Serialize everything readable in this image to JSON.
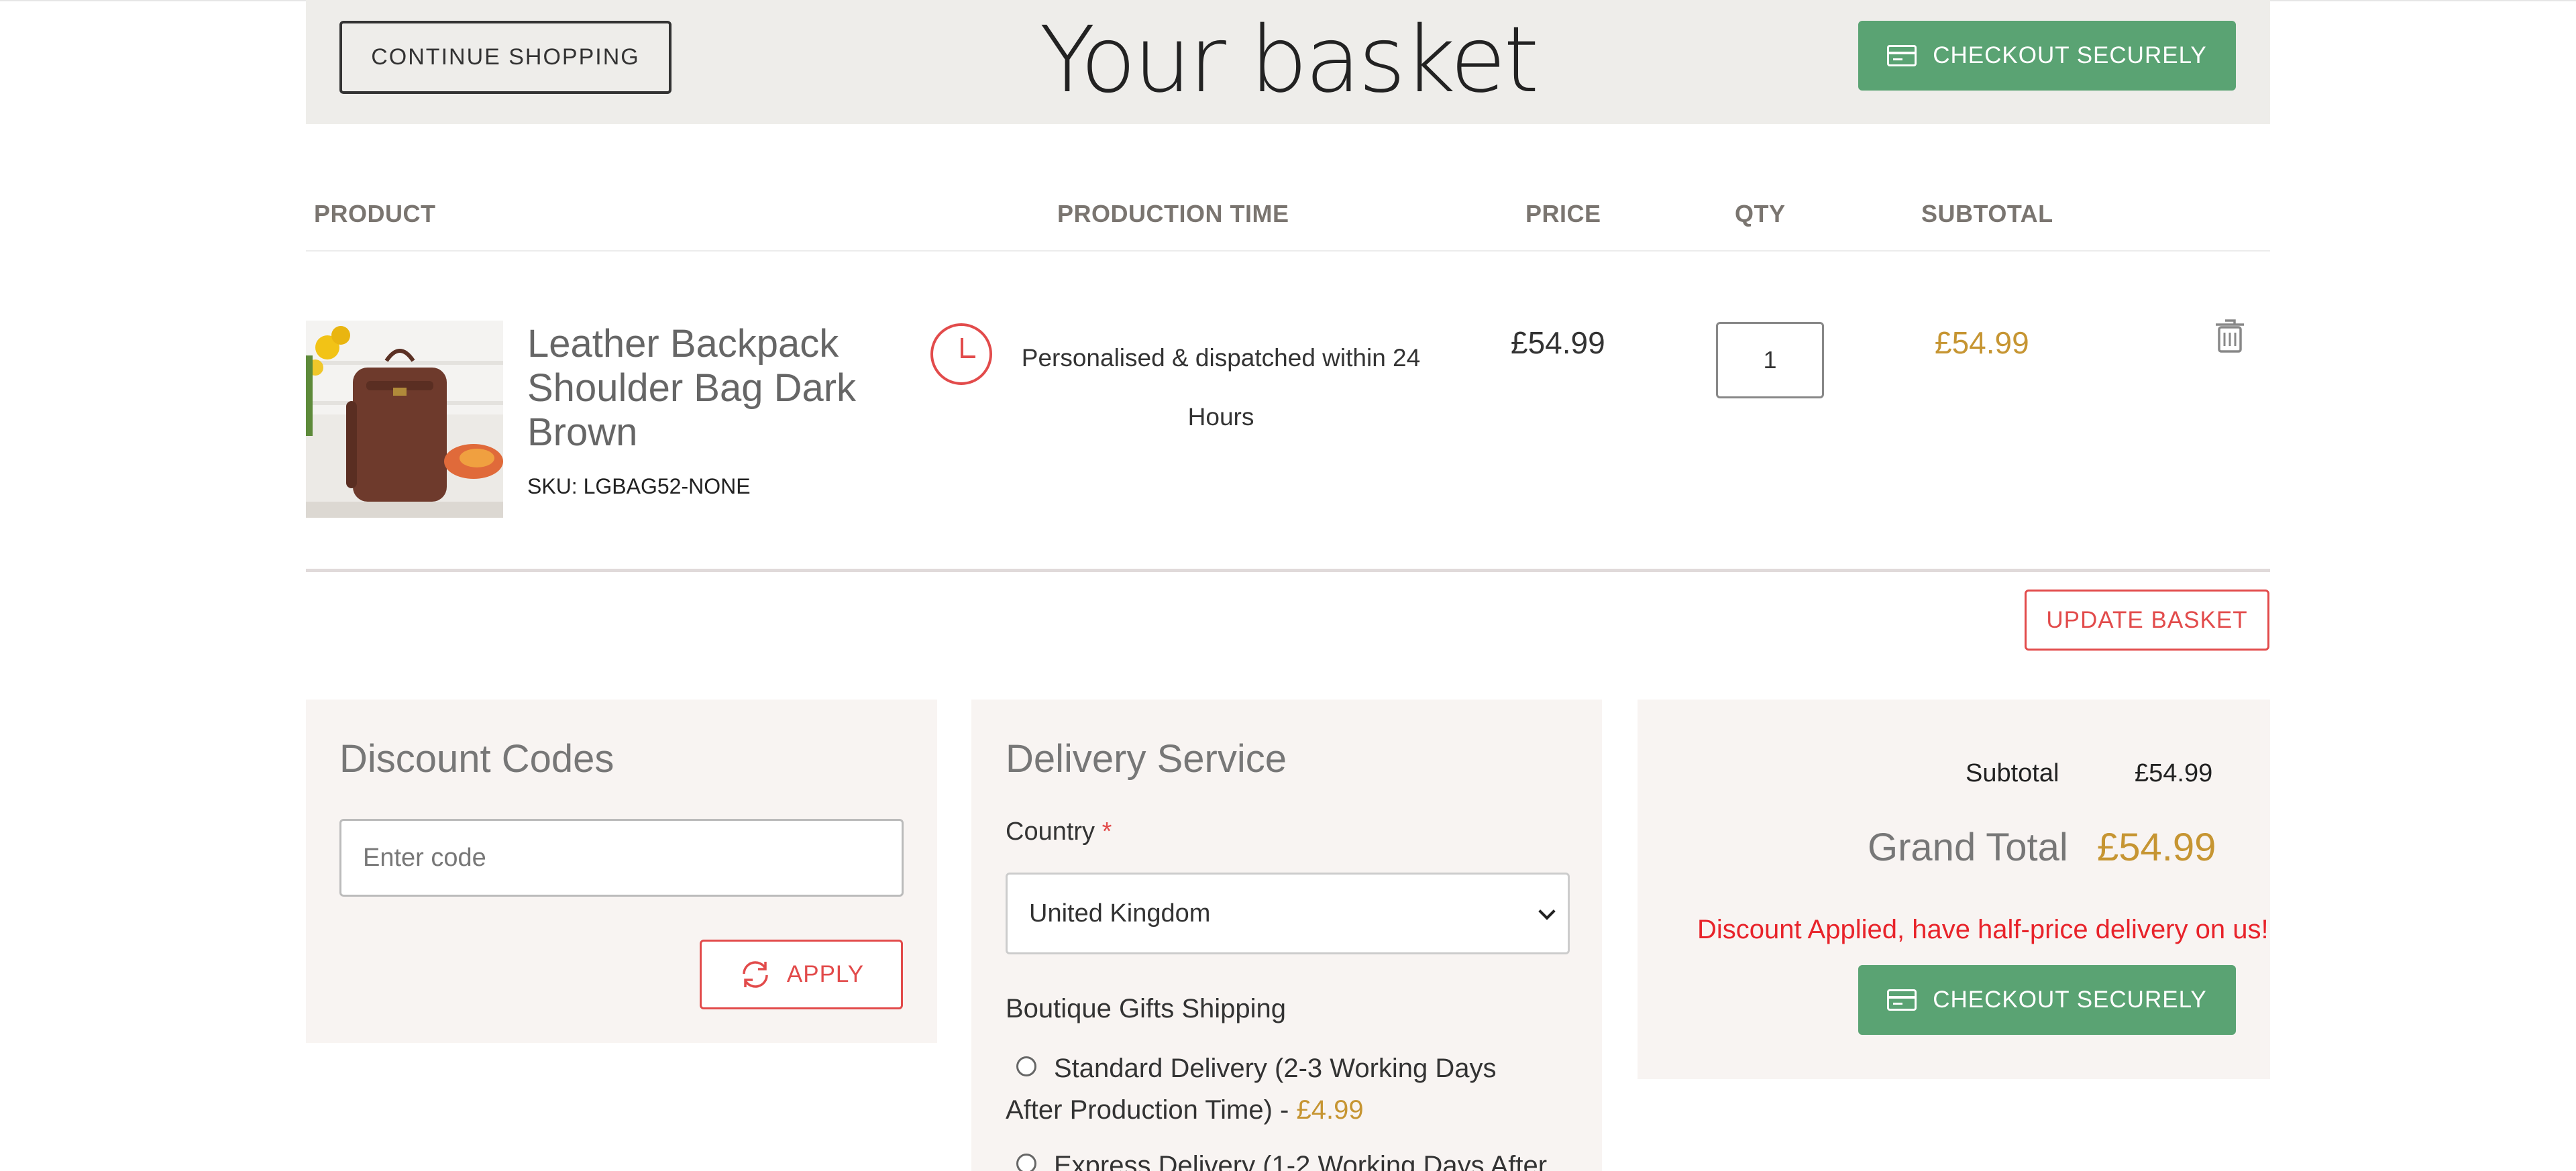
{
  "header": {
    "continue_label": "CONTINUE SHOPPING",
    "title": "Your basket",
    "checkout_label": "CHECKOUT SECURELY"
  },
  "table": {
    "headers": {
      "product": "PRODUCT",
      "production_time": "PRODUCTION TIME",
      "price": "PRICE",
      "qty": "QTY",
      "subtotal": "SUBTOTAL"
    },
    "rows": [
      {
        "name": "Leather Backpack Shoulder Bag Dark Brown",
        "sku": "SKU: LGBAG52-NONE",
        "production_time": "Personalised & dispatched within 24 Hours",
        "price": "£54.99",
        "qty": "1",
        "subtotal": "£54.99"
      }
    ]
  },
  "update_label": "UPDATE BASKET",
  "discount": {
    "title": "Discount Codes",
    "placeholder": "Enter code",
    "apply_label": "APPLY"
  },
  "delivery": {
    "title": "Delivery Service",
    "country_label": "Country",
    "required_mark": "*",
    "country_value": "United Kingdom",
    "shipping_title": "Boutique Gifts Shipping",
    "options": [
      {
        "text": "Standard Delivery (2-3 Working Days After Production Time) - ",
        "price": "£4.99"
      },
      {
        "text": "Express Delivery (1-2 Working Days After",
        "price": ""
      }
    ]
  },
  "summary": {
    "subtotal_label": "Subtotal",
    "subtotal_value": "£54.99",
    "grand_label": "Grand Total",
    "grand_value": "£54.99",
    "discount_note": "Discount Applied, have half-price delivery on us!",
    "checkout_label": "CHECKOUT SECURELY"
  },
  "colors": {
    "accent_green": "#5aa373",
    "accent_red": "#e24b4b",
    "gold": "#c69532",
    "header_bg": "#eeedea",
    "panel_bg": "#f8f4f2"
  }
}
